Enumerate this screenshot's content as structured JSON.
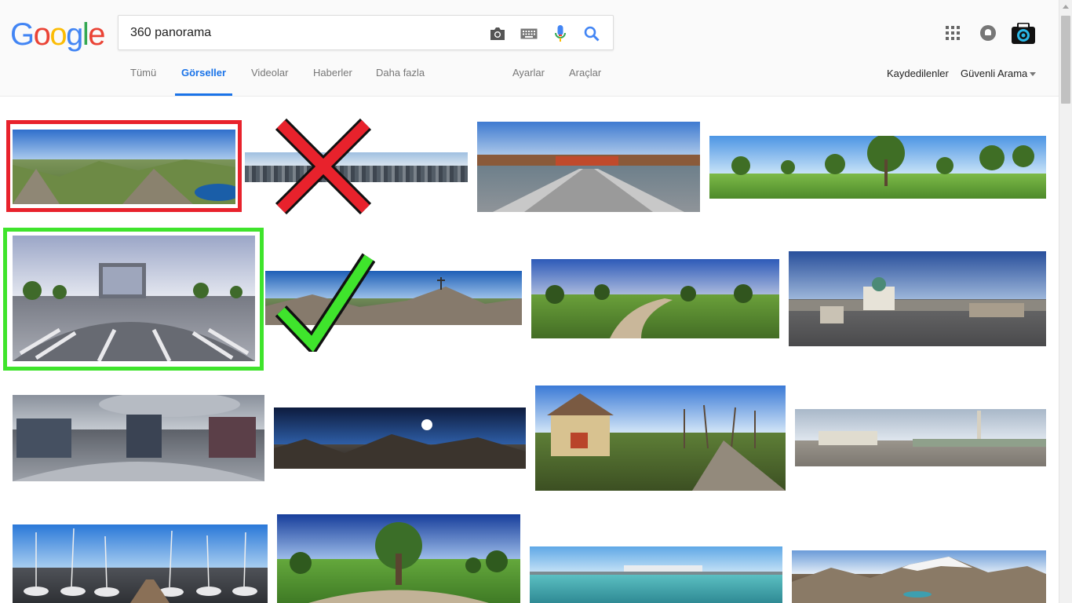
{
  "logo": {
    "text": "Google",
    "letters": [
      "G",
      "o",
      "o",
      "g",
      "l",
      "e"
    ],
    "colors": [
      "#4285f4",
      "#ea4335",
      "#fbbc05",
      "#4285f4",
      "#34a853",
      "#ea4335"
    ]
  },
  "search": {
    "query": "360 panorama",
    "camera_icon": "camera-icon",
    "keyboard_icon": "keyboard-icon",
    "mic_icon": "mic-icon",
    "search_icon": "search-icon"
  },
  "tabs": [
    {
      "label": "Tümü"
    },
    {
      "label": "Görseller"
    },
    {
      "label": "Videolar"
    },
    {
      "label": "Haberler"
    },
    {
      "label": "Daha fazla"
    },
    {
      "label": "Ayarlar"
    },
    {
      "label": "Araçlar"
    }
  ],
  "right_links": {
    "saved": "Kaydedilenler",
    "safe_search": "Güvenli Arama"
  },
  "colors": {
    "accent": "#1a73e8",
    "reject_mark": "#e8222c",
    "accept_mark": "#3fe42c"
  },
  "results": [
    {
      "desc": "mountain panorama with lake",
      "sky": "#4a8fd8",
      "land": "#5e7a3c"
    },
    {
      "desc": "city aerial panorama",
      "sky": "#b9cfe3",
      "land": "#4f5963"
    },
    {
      "desc": "harbor boardwalk little planet",
      "sky": "#6f9fd4",
      "land": "#7b8d96"
    },
    {
      "desc": "park with trees panorama",
      "sky": "#8cc2ef",
      "land": "#5a9b3a"
    },
    {
      "desc": "street equirectangular",
      "sky": "#c9cfe0",
      "land": "#8b8e98"
    },
    {
      "desc": "alpine summit cross",
      "sky": "#3d72bd",
      "land": "#7c7063"
    },
    {
      "desc": "field path panorama",
      "sky": "#4c74c6",
      "land": "#5d8a34"
    },
    {
      "desc": "city square cathedral",
      "sky": "#5278b3",
      "land": "#5e5e62"
    },
    {
      "desc": "sony center dome",
      "sky": "#9aa1ab",
      "land": "#6c7078"
    },
    {
      "desc": "mountain ridge at night",
      "sky": "#16284e",
      "land": "#3d3a35"
    },
    {
      "desc": "garden house fisheye",
      "sky": "#6aa4e4",
      "land": "#4b6a2c"
    },
    {
      "desc": "trafalgar square",
      "sky": "#b7c6d6",
      "land": "#8c8a84"
    },
    {
      "desc": "marina sailboats",
      "sky": "#4b92e0",
      "land": "#5f6166"
    },
    {
      "desc": "park tree little planet",
      "sky": "#3c6bc4",
      "land": "#5ea23b"
    },
    {
      "desc": "sea beach panorama",
      "sky": "#7fbfe8",
      "land": "#55b3b8"
    },
    {
      "desc": "snowy mountains valley",
      "sky": "#8fb5df",
      "land": "#6e5a46"
    }
  ]
}
